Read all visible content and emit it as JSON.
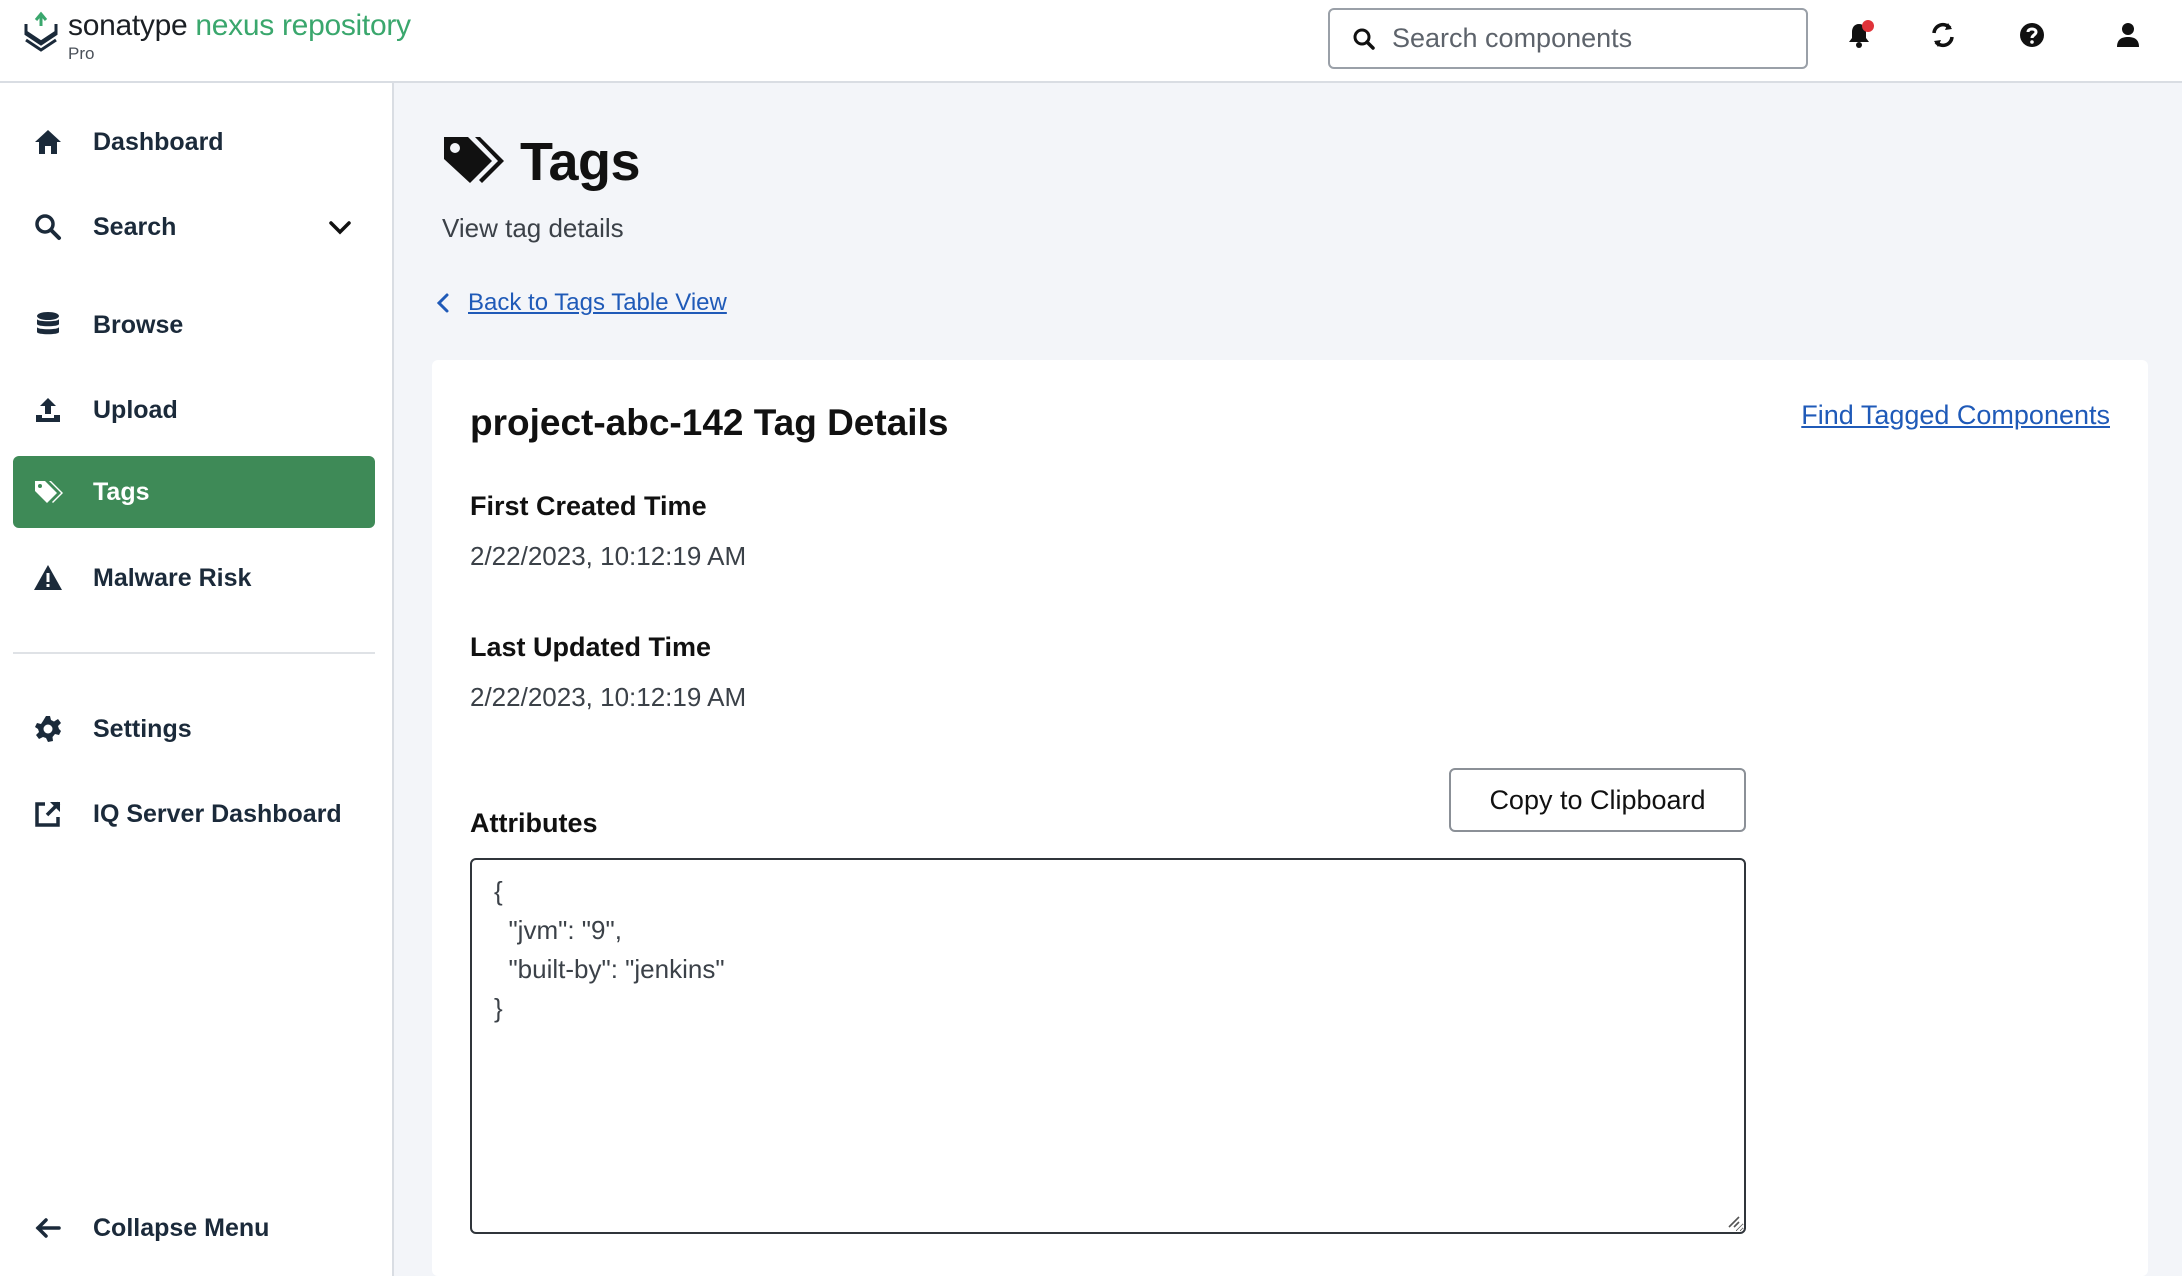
{
  "header": {
    "brand_name": "sonatype",
    "product_name": "nexus repository",
    "edition": "Pro",
    "search_placeholder": "Search components",
    "icons": [
      "bell-icon",
      "refresh-icon",
      "help-icon",
      "user-icon"
    ],
    "notification_dot_color": "#e0333a"
  },
  "sidebar": {
    "items": [
      {
        "label": "Dashboard",
        "icon": "home-icon"
      },
      {
        "label": "Search",
        "icon": "search-icon",
        "expandable": true
      },
      {
        "label": "Browse",
        "icon": "database-icon"
      },
      {
        "label": "Upload",
        "icon": "upload-icon"
      },
      {
        "label": "Tags",
        "icon": "tags-icon",
        "active": true
      },
      {
        "label": "Malware Risk",
        "icon": "warning-icon"
      },
      {
        "label": "Settings",
        "icon": "gear-icon"
      },
      {
        "label": "IQ Server Dashboard",
        "icon": "external-link-icon"
      }
    ],
    "collapse_label": "Collapse Menu",
    "active_color": "#3e8a57"
  },
  "page": {
    "title": "Tags",
    "subtitle": "View tag details",
    "back_link": "Back to Tags Table View"
  },
  "details": {
    "heading": "project-abc-142 Tag Details",
    "find_link": "Find Tagged Components",
    "first_created_label": "First Created Time",
    "first_created_value": "2/22/2023, 10:12:19 AM",
    "last_updated_label": "Last Updated Time",
    "last_updated_value": "2/22/2023, 10:12:19 AM",
    "attributes_label": "Attributes",
    "copy_button": "Copy to Clipboard",
    "attributes_text": "{\n  \"jvm\": \"9\",\n  \"built-by\": \"jenkins\"\n}"
  },
  "colors": {
    "accent_green": "#3aa76d",
    "link_blue": "#1f5ab8",
    "page_bg": "#f3f5f9"
  }
}
